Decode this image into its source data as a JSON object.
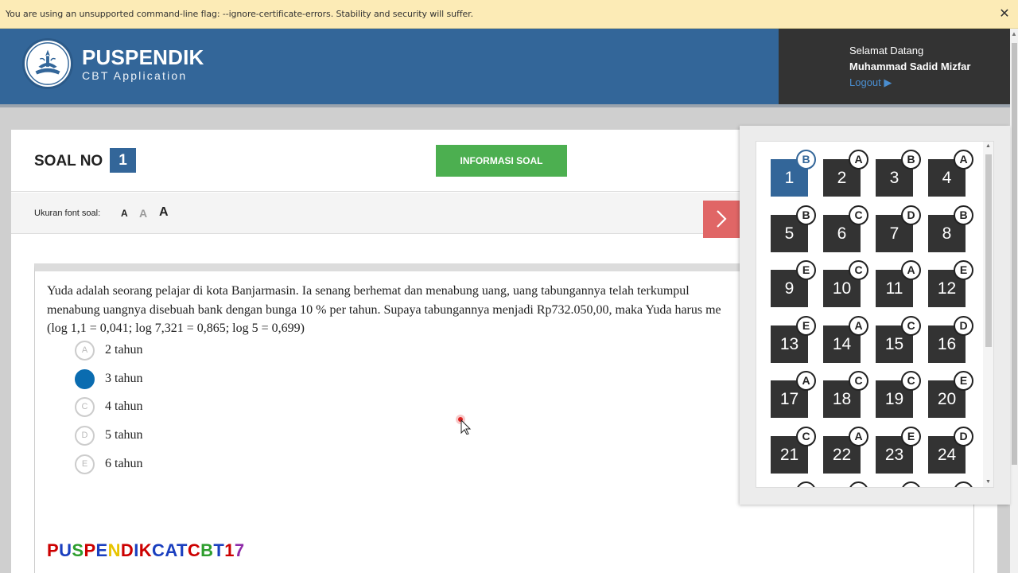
{
  "infobar": {
    "text": "You are using an unsupported command-line flag: --ignore-certificate-errors. Stability and security will suffer.",
    "close": "✕"
  },
  "header": {
    "brand_title": "PUSPENDIK",
    "brand_subtitle": "CBT Application",
    "greeting": "Selamat Datang",
    "user_name": "Muhammad Sadid Mizfar",
    "logout": "Logout ▶"
  },
  "soal": {
    "label": "SOAL NO",
    "number": "1",
    "info_button": "INFORMASI SOAL",
    "font_label": "Ukuran font soal:",
    "font_small": "A",
    "font_medium": "A",
    "font_large": "A"
  },
  "question": {
    "lines": [
      "Yuda adalah seorang pelajar di kota Banjarmasin. Ia senang berhemat dan menabung uang, uang tabungannya telah terkumpul",
      "menabung uangnya disebuah bank dengan bunga 10 % per tahun. Supaya tabungannya menjadi Rp732.050,00, maka Yuda harus me",
      "(log 1,1 = 0,041; log 7,321 = 0,865; log 5 = 0,699)"
    ],
    "options": [
      {
        "letter": "A",
        "text": "2 tahun",
        "selected": false
      },
      {
        "letter": "B",
        "text": "3 tahun",
        "selected": true
      },
      {
        "letter": "C",
        "text": "4 tahun",
        "selected": false
      },
      {
        "letter": "D",
        "text": "5 tahun",
        "selected": false
      },
      {
        "letter": "E",
        "text": "6 tahun",
        "selected": false
      }
    ]
  },
  "watermark": {
    "letters": [
      "P",
      "U",
      "S",
      "P",
      "E",
      "N",
      "D",
      "I",
      "K",
      "C",
      "A",
      "T",
      "C",
      "B",
      "T",
      "1",
      "7"
    ],
    "colors": [
      "#cc0000",
      "#1a3fbf",
      "#2e9e2e",
      "#cc0000",
      "#1a3fbf",
      "#e8c400",
      "#cc0000",
      "#1a3fbf",
      "#cc0000",
      "#1a3fbf",
      "#1a3fbf",
      "#1a3fbf",
      "#cc0000",
      "#2e9e2e",
      "#1a3fbf",
      "#cc0000",
      "#8e2aa8"
    ]
  },
  "navigation": {
    "questions": [
      {
        "num": "1",
        "answer": "B",
        "active": true
      },
      {
        "num": "2",
        "answer": "A",
        "active": false
      },
      {
        "num": "3",
        "answer": "B",
        "active": false
      },
      {
        "num": "4",
        "answer": "A",
        "active": false
      },
      {
        "num": "5",
        "answer": "B",
        "active": false
      },
      {
        "num": "6",
        "answer": "C",
        "active": false
      },
      {
        "num": "7",
        "answer": "D",
        "active": false
      },
      {
        "num": "8",
        "answer": "B",
        "active": false
      },
      {
        "num": "9",
        "answer": "E",
        "active": false
      },
      {
        "num": "10",
        "answer": "C",
        "active": false
      },
      {
        "num": "11",
        "answer": "A",
        "active": false
      },
      {
        "num": "12",
        "answer": "E",
        "active": false
      },
      {
        "num": "13",
        "answer": "E",
        "active": false
      },
      {
        "num": "14",
        "answer": "A",
        "active": false
      },
      {
        "num": "15",
        "answer": "C",
        "active": false
      },
      {
        "num": "16",
        "answer": "D",
        "active": false
      },
      {
        "num": "17",
        "answer": "A",
        "active": false
      },
      {
        "num": "18",
        "answer": "C",
        "active": false
      },
      {
        "num": "19",
        "answer": "C",
        "active": false
      },
      {
        "num": "20",
        "answer": "E",
        "active": false
      },
      {
        "num": "21",
        "answer": "C",
        "active": false
      },
      {
        "num": "22",
        "answer": "A",
        "active": false
      },
      {
        "num": "23",
        "answer": "E",
        "active": false
      },
      {
        "num": "24",
        "answer": "D",
        "active": false
      }
    ]
  },
  "colors": {
    "header_blue": "#336699",
    "user_panel": "#333333",
    "info_green": "#4caf50",
    "next_red": "#e06666",
    "selected_option": "#0a6cb0"
  }
}
